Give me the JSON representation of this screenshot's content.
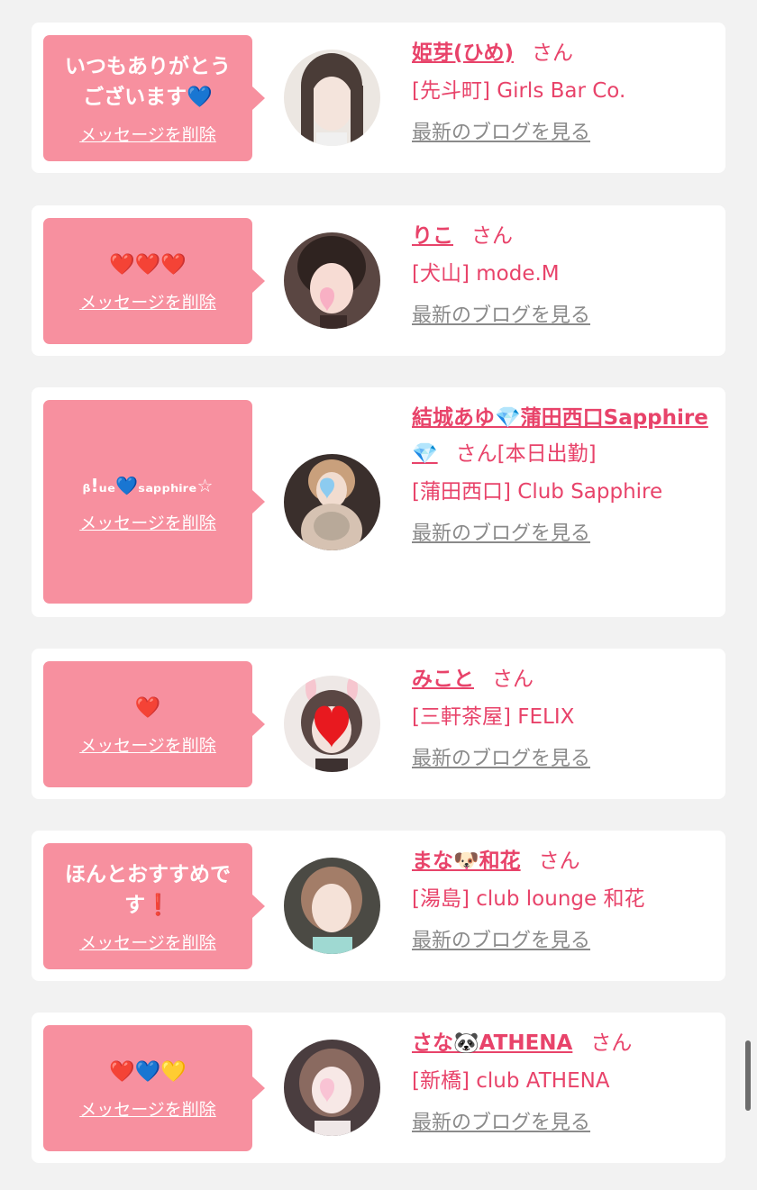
{
  "cards": [
    {
      "message": "いつもありがとう\nございます💙",
      "delete_label": "メッセージを削除",
      "name": "姫芽(ひめ)",
      "honorific": "さん",
      "shop": "[先斗町] Girls Bar Co.",
      "blog_label": "最新のブログを見る"
    },
    {
      "message": "❤️❤️❤️",
      "delete_label": "メッセージを削除",
      "name": "りこ",
      "honorific": "さん",
      "shop": "[犬山] mode.M",
      "blog_label": "最新のブログを見る"
    },
    {
      "message": "ᵦ!ᵤₑ💙ₛₐₚₚₕᵢᵣₑ☆",
      "delete_label": "メッセージを削除",
      "name": "結城あゆ💎蒲田西口Sapphire💎",
      "honorific": "さん[本日出勤]",
      "shop": "[蒲田西口] Club Sapphire",
      "blog_label": "最新のブログを見る"
    },
    {
      "message": "❤️",
      "delete_label": "メッセージを削除",
      "name": "みこと",
      "honorific": "さん",
      "shop": "[三軒茶屋] FELIX",
      "blog_label": "最新のブログを見る"
    },
    {
      "message": "ほんとおすすめで\nす❗️",
      "delete_label": "メッセージを削除",
      "name": "まな🐶和花",
      "honorific": "さん",
      "shop": "[湯島] club lounge 和花",
      "blog_label": "最新のブログを見る"
    },
    {
      "message": "❤️💙💛",
      "delete_label": "メッセージを削除",
      "name": "さな🐼ATHENA",
      "honorific": "さん",
      "shop": "[新橋] club ATHENA",
      "blog_label": "最新のブログを見る"
    }
  ],
  "colors": {
    "accent": "#e8436a",
    "bubble": "#f7909f",
    "link_gray": "#8a8a8a",
    "background": "#f2f2f2"
  }
}
